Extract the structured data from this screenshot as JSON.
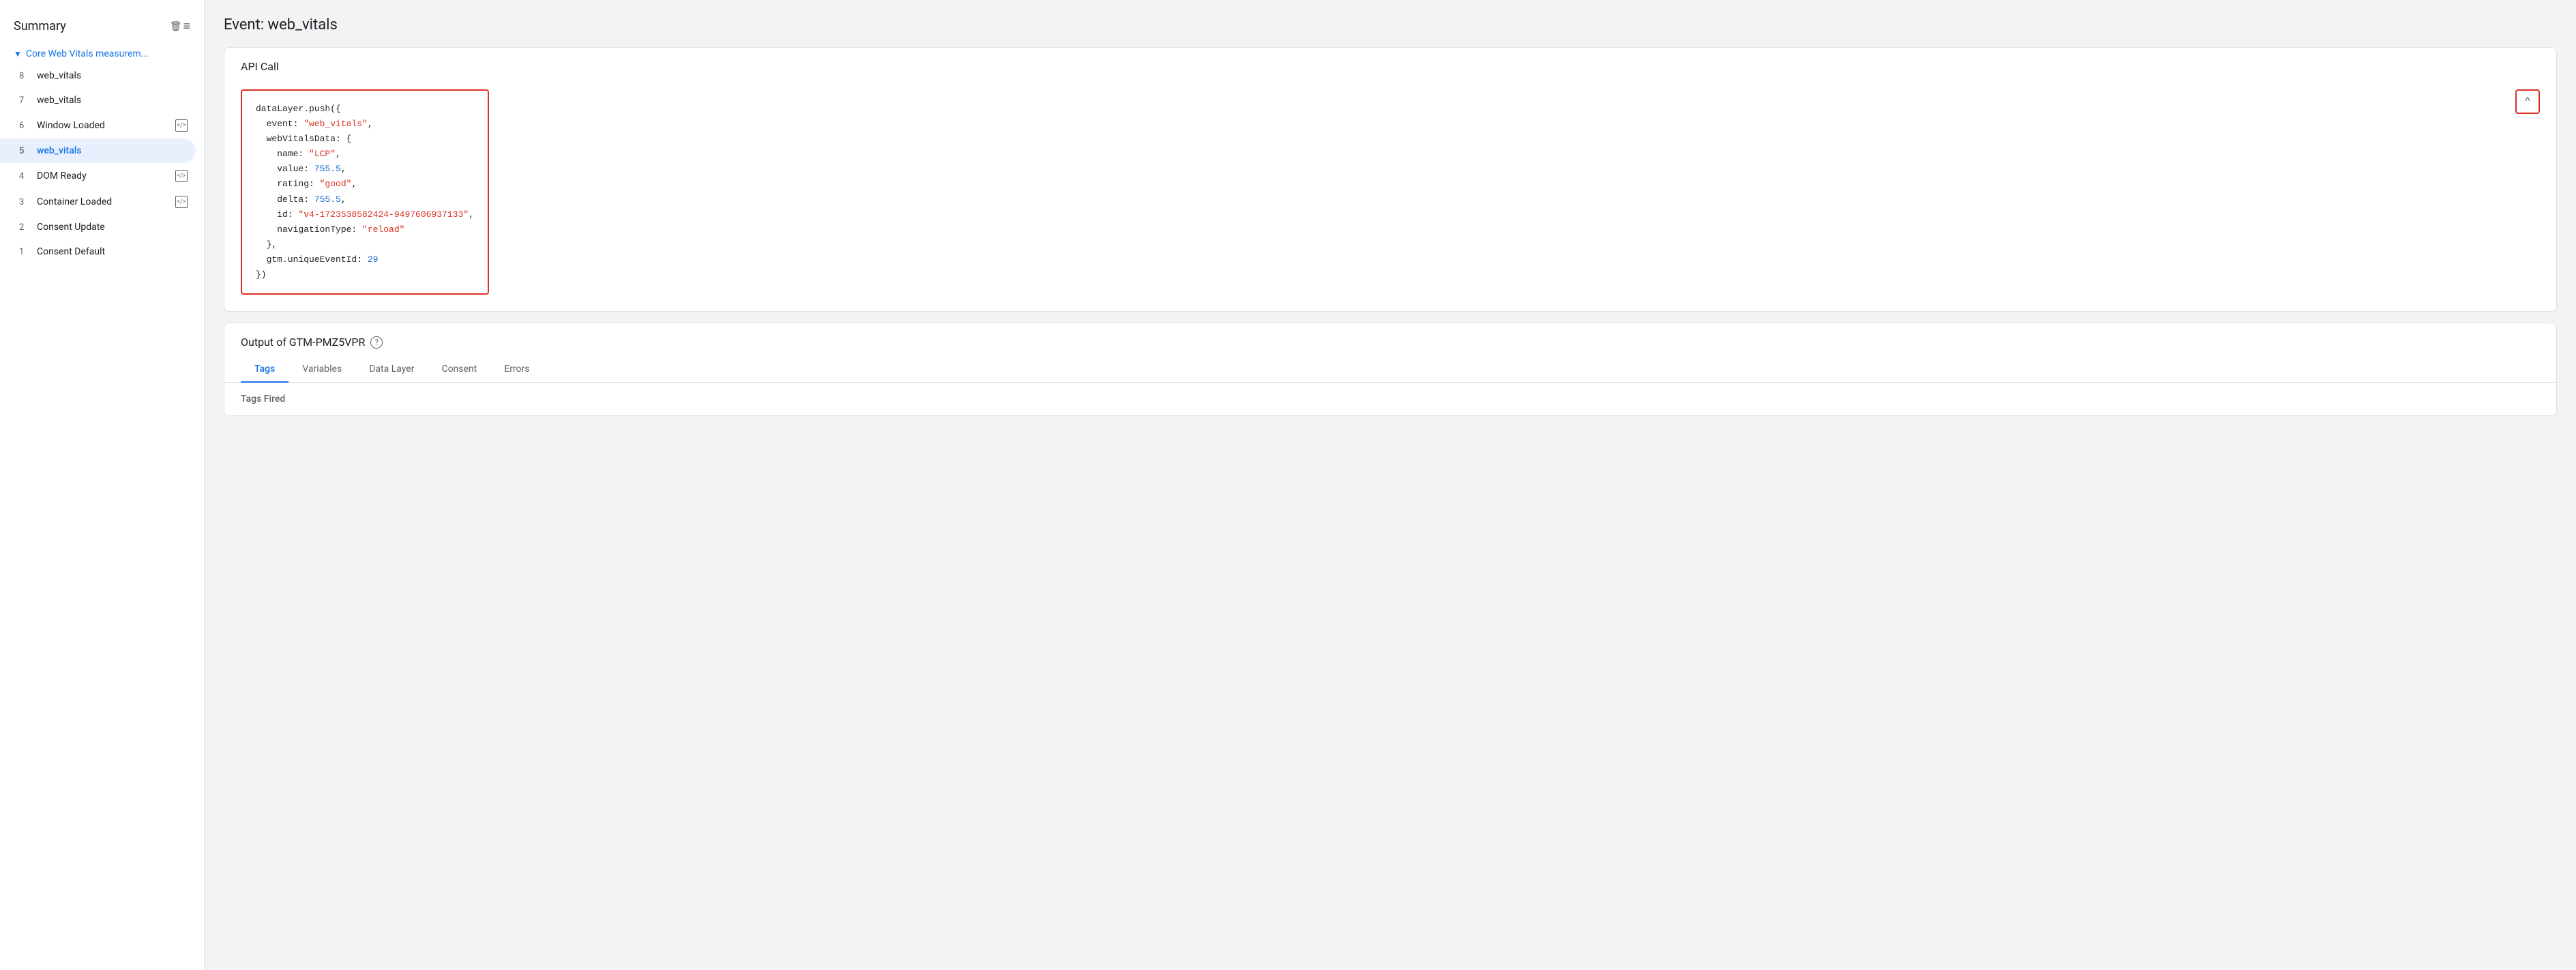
{
  "sidebar": {
    "title": "Summary",
    "delete_icon": "🗑",
    "filter_icon": "≡",
    "section": {
      "chevron": "▼",
      "label": "Core Web Vitals measurem..."
    },
    "items": [
      {
        "number": "8",
        "label": "web_vitals",
        "active": false,
        "has_icon": false
      },
      {
        "number": "7",
        "label": "web_vitals",
        "active": false,
        "has_icon": false
      },
      {
        "number": "6",
        "label": "Window Loaded",
        "active": false,
        "has_icon": true
      },
      {
        "number": "5",
        "label": "web_vitals",
        "active": true,
        "has_icon": false
      },
      {
        "number": "4",
        "label": "DOM Ready",
        "active": false,
        "has_icon": true
      },
      {
        "number": "3",
        "label": "Container Loaded",
        "active": false,
        "has_icon": true
      },
      {
        "number": "2",
        "label": "Consent Update",
        "active": false,
        "has_icon": false
      },
      {
        "number": "1",
        "label": "Consent Default",
        "active": false,
        "has_icon": false
      }
    ]
  },
  "main": {
    "page_title": "Event: web_vitals",
    "api_call": {
      "header": "API Call",
      "collapse_icon": "^",
      "code": {
        "line1": "dataLayer.push({",
        "line2_key": "  event: ",
        "line2_val": "\"web_vitals\"",
        "line2_end": ",",
        "line3": "  webVitalsData: {",
        "line4_key": "    name: ",
        "line4_val": "\"LCP\"",
        "line4_end": ",",
        "line5_key": "    value: ",
        "line5_val": "755.5",
        "line5_end": ",",
        "line6_key": "    rating: ",
        "line6_val": "\"good\"",
        "line6_end": ",",
        "line7_key": "    delta: ",
        "line7_val": "755.5",
        "line7_end": ",",
        "line8_key": "    id: ",
        "line8_val": "\"v4-1723538582424-9497606937133\"",
        "line8_end": ",",
        "line9_key": "    navigationType: ",
        "line9_val": "\"reload\"",
        "line10": "  },",
        "line11_key": "  gtm.uniqueEventId: ",
        "line11_val": "29",
        "line12": "})"
      }
    },
    "output": {
      "header": "Output of GTM-PMZ5VPR",
      "help_icon": "?",
      "tabs": [
        {
          "label": "Tags",
          "active": true
        },
        {
          "label": "Variables",
          "active": false
        },
        {
          "label": "Data Layer",
          "active": false
        },
        {
          "label": "Consent",
          "active": false
        },
        {
          "label": "Errors",
          "active": false
        }
      ],
      "tags_fired_label": "Tags Fired"
    }
  }
}
